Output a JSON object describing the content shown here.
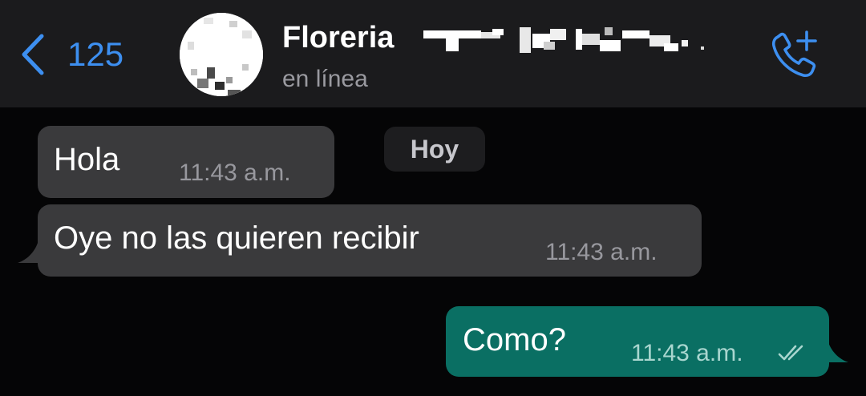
{
  "header": {
    "back_count": "125",
    "contact_name": "Floreria",
    "status": "en línea",
    "icons": {
      "back": "chevron-left-icon",
      "call": "phone-add-icon"
    }
  },
  "date_separator": "Hoy",
  "messages": [
    {
      "direction": "incoming",
      "text": "Hola",
      "time": "11:43 a.m."
    },
    {
      "direction": "incoming",
      "text": "Oye no las quieren recibir",
      "time": "11:43 a.m."
    },
    {
      "direction": "outgoing",
      "text": "Como?",
      "time": "11:43 a.m.",
      "status": "read"
    }
  ],
  "colors": {
    "header_bg": "#1b1b1d",
    "chat_bg": "#050506",
    "accent_blue": "#3d8ff0",
    "incoming_bubble": "#3a3a3c",
    "outgoing_bubble": "#0a6f63"
  }
}
